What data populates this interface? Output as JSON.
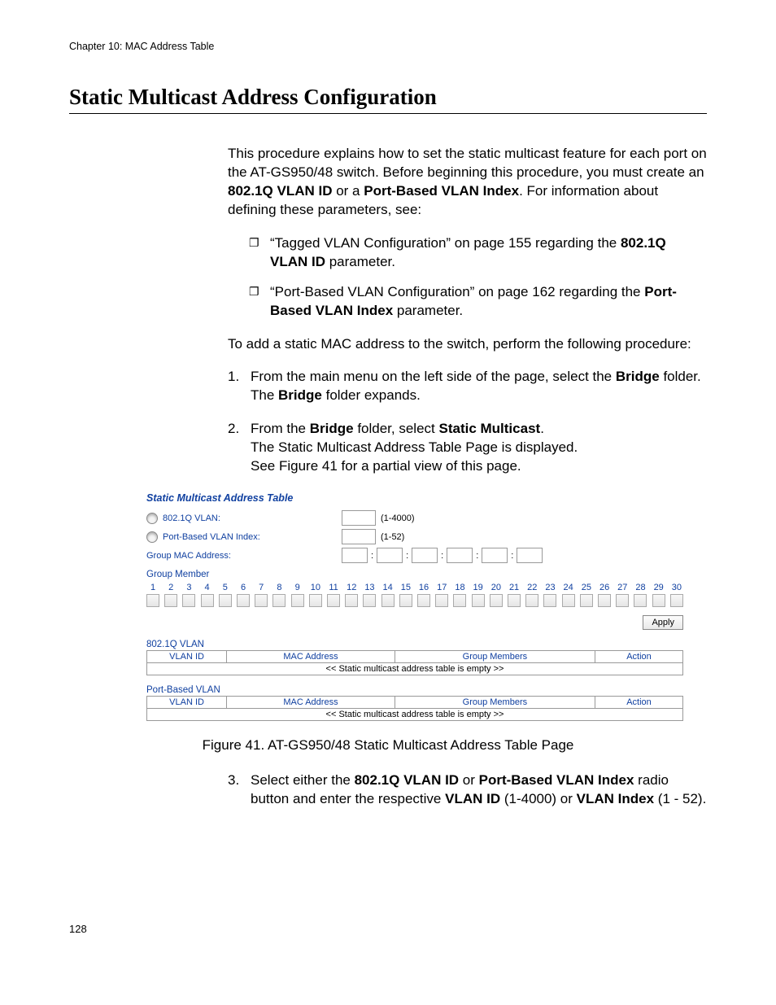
{
  "chapter_header": "Chapter 10: MAC Address Table",
  "section_title": "Static Multicast Address Configuration",
  "intro_p1a": "This procedure explains how to set the static multicast feature for each port on the AT-GS950/48 switch. Before beginning this procedure, you must create an ",
  "intro_p1b": "802.1Q VLAN ID",
  "intro_p1c": " or a ",
  "intro_p1d": "Port-Based VLAN Index",
  "intro_p1e": ". For information about defining these parameters, see:",
  "bullet1a": "“Tagged VLAN Configuration” on page 155 regarding the ",
  "bullet1b": "802.1Q VLAN ID",
  "bullet1c": " parameter.",
  "bullet2a": "“Port-Based VLAN Configuration” on page 162 regarding the ",
  "bullet2b": "Port-Based VLAN Index",
  "bullet2c": " parameter.",
  "intro_p2": "To add a static MAC address to the switch, perform the following procedure:",
  "step1a": "From the main menu on the left side of the page, select the ",
  "step1b": "Bridge",
  "step1c": " folder.",
  "step1d": "The ",
  "step1e": "Bridge",
  "step1f": " folder expands.",
  "step2a": "From the ",
  "step2b": "Bridge",
  "step2c": " folder, select ",
  "step2d": "Static Multicast",
  "step2e": ".",
  "step2f": "The Static Multicast Address Table Page is displayed.",
  "step2g": "See Figure 41 for a partial view of this page.",
  "figure": {
    "title": "Static Multicast Address Table",
    "radio1": "802.1Q VLAN:",
    "radio1_range": "(1-4000)",
    "radio2": "Port-Based VLAN Index:",
    "radio2_range": "(1-52)",
    "mac_label": "Group MAC Address:",
    "member_label": "Group Member",
    "port_numbers": [
      "1",
      "2",
      "3",
      "4",
      "5",
      "6",
      "7",
      "8",
      "9",
      "10",
      "11",
      "12",
      "13",
      "14",
      "15",
      "16",
      "17",
      "18",
      "19",
      "20",
      "21",
      "22",
      "23",
      "24",
      "25",
      "26",
      "27",
      "28",
      "29",
      "30"
    ],
    "apply": "Apply",
    "section1": "802.1Q VLAN",
    "section2": "Port-Based VLAN",
    "cols": {
      "vid": "VLAN ID",
      "mac": "MAC Address",
      "grp": "Group Members",
      "act": "Action"
    },
    "empty_msg": "<< Static multicast address table is empty >>"
  },
  "figure_caption": "Figure 41. AT-GS950/48 Static Multicast Address Table Page",
  "step3a": "Select either the ",
  "step3b": "802.1Q VLAN ID",
  "step3c": " or ",
  "step3d": "Port-Based VLAN Index",
  "step3e": " radio button and enter the respective ",
  "step3f": "VLAN ID",
  "step3g": " (1-4000) or ",
  "step3h": "VLAN Index",
  "step3i": " (1 - 52).",
  "page_number": "128"
}
